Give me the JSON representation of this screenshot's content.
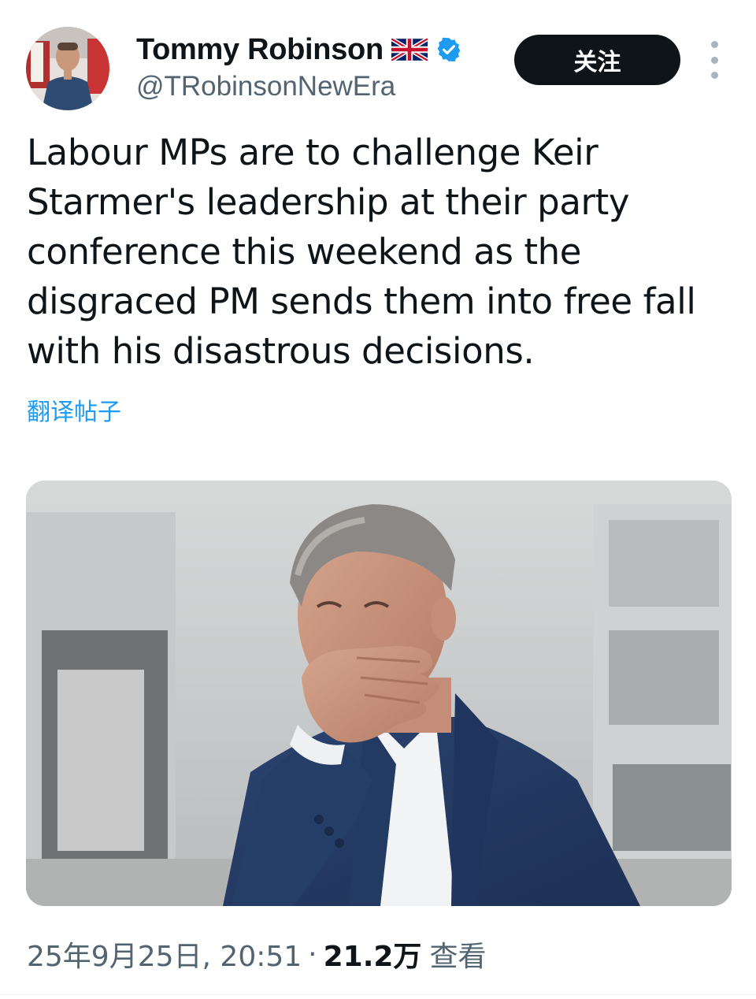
{
  "author": {
    "display_name": "Tommy Robinson",
    "handle": "@TRobinsonNewEra",
    "flag_icon": "uk-flag-icon",
    "verified_icon": "verified-badge-icon",
    "verified_color": "#1d9bf0"
  },
  "follow_button": {
    "label": "关注",
    "background": "#0f1419"
  },
  "more_icon": "more-vertical-icon",
  "post": {
    "text": "Labour MPs are to challenge Keir Starmer's leadership at their party conference this weekend as the disgraced PM sends them into free fall with his disastrous decisions.",
    "translate_label": "翻译帖子",
    "link_color": "#1d9bf0"
  },
  "meta": {
    "timestamp": "25年9月25日, 20:51",
    "separator": "·",
    "views_count": "21.2万",
    "views_label": "查看"
  }
}
